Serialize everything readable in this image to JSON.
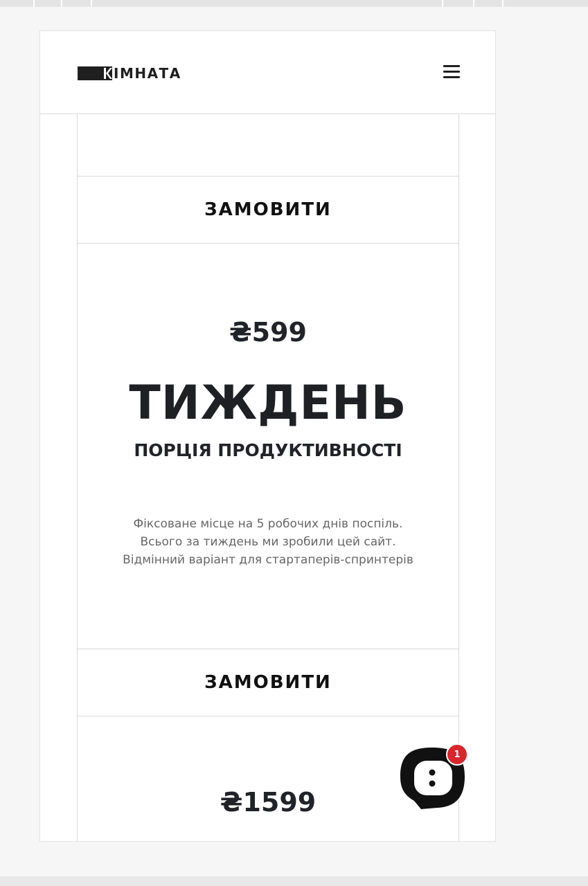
{
  "brand": {
    "logo_text": "ІМНАТА",
    "logo_full": "КІМНАТА"
  },
  "header": {
    "menu_icon": "hamburger-menu-icon"
  },
  "plans": [
    {
      "order_label": "ЗАМОВИТИ"
    },
    {
      "price": "₴599",
      "title": "ТИЖДЕНЬ",
      "subtitle": "ПОРЦІЯ ПРОДУКТИВНОСТІ",
      "description": [
        "Фіксоване місце на 5 робочих днів поспіль.",
        "Всього за тиждень ми зробили цей сайт.",
        "Відмінний варіант для стартаперів-спринтерів"
      ],
      "order_label": "ЗАМОВИТИ"
    },
    {
      "price": "₴1599"
    }
  ],
  "chat": {
    "icon": "chat-bubble-icon",
    "badge_count": "1",
    "badge_color": "#d9262c"
  },
  "colors": {
    "text_dark": "#1f2023",
    "text_muted": "#666666",
    "border": "#d9d9d9"
  }
}
